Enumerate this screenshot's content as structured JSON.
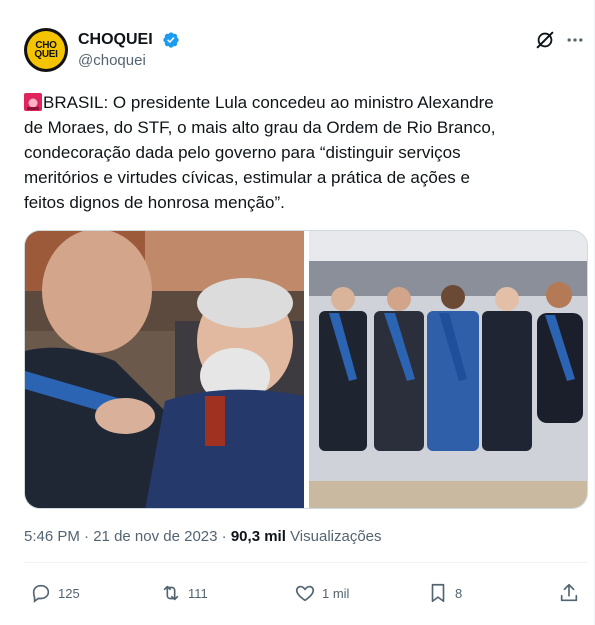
{
  "author": {
    "display_name": "CHOQUEI",
    "handle": "@choquei",
    "avatar_text_top": "CHO",
    "avatar_text_bottom": "QUEI"
  },
  "tweet": {
    "text": "BRASIL: O presidente Lula concedeu ao ministro Alexandre\nde Moraes, do STF, o mais alto grau da Ordem de Rio Branco,\ncondecoração dada pelo governo para “distinguir serviços\nmeritórios e virtudes cívicas, estimular a prática de ações e\nfeitos dignos de honrosa menção”."
  },
  "meta": {
    "time": "5:46 PM",
    "sep": " · ",
    "date": "21 de nov de 2023",
    "views_count": "90,3 mil",
    "views_label": "Visualizações"
  },
  "actions": {
    "replies": "125",
    "retweets": "111",
    "likes": "1 mil",
    "bookmarks": "8"
  },
  "colors": {
    "verified_blue": "#1d9bf0",
    "muted": "#536471",
    "siren_red": "#e0245e"
  }
}
